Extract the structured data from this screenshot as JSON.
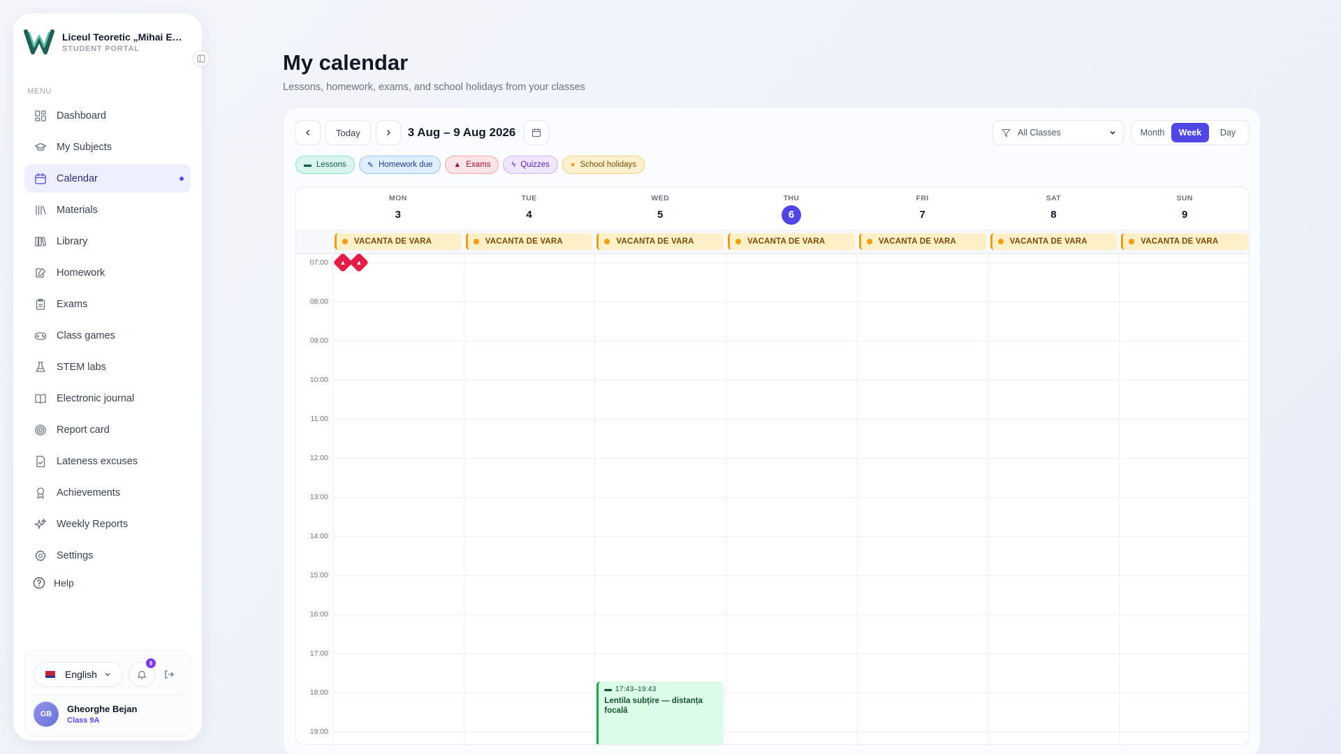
{
  "sidebar": {
    "school_name": "Liceul Teoretic „Mihai Emi…",
    "portal": "STUDENT PORTAL",
    "menu_label": "MENU",
    "items": [
      {
        "label": "Dashboard",
        "icon": "dashboard-icon"
      },
      {
        "label": "My Subjects",
        "icon": "graduation-cap-icon"
      },
      {
        "label": "Calendar",
        "icon": "calendar-icon",
        "active": true
      },
      {
        "label": "Materials",
        "icon": "materials-icon"
      },
      {
        "label": "Library",
        "icon": "library-icon"
      },
      {
        "label": "Homework",
        "icon": "homework-icon"
      },
      {
        "label": "Exams",
        "icon": "clipboard-icon"
      },
      {
        "label": "Class games",
        "icon": "gamepad-icon"
      },
      {
        "label": "STEM labs",
        "icon": "flask-icon"
      },
      {
        "label": "Electronic journal",
        "icon": "book-open-icon"
      },
      {
        "label": "Report card",
        "icon": "target-icon"
      },
      {
        "label": "Lateness excuses",
        "icon": "file-check-icon"
      },
      {
        "label": "Achievements",
        "icon": "award-icon"
      },
      {
        "label": "Weekly Reports",
        "icon": "sparkles-icon"
      },
      {
        "label": "Settings",
        "icon": "gear-icon"
      }
    ],
    "help": "Help",
    "language": "English",
    "notifications_count": "9",
    "user": {
      "initials": "GB",
      "name": "Gheorghe Bejan",
      "class": "Class 9A"
    }
  },
  "page": {
    "title": "My calendar",
    "subtitle": "Lessons, homework, exams, and school holidays from your classes"
  },
  "toolbar": {
    "today": "Today",
    "range": "3 Aug – 9 Aug 2026",
    "filter": "All Classes",
    "views": [
      "Month",
      "Week",
      "Day"
    ],
    "active_view": "Week"
  },
  "legend": [
    {
      "label": "Lessons",
      "icon": "book-icon"
    },
    {
      "label": "Homework due",
      "icon": "pencil-icon"
    },
    {
      "label": "Exams",
      "icon": "graduation-cap-icon"
    },
    {
      "label": "Quizzes",
      "icon": "lightning-icon"
    },
    {
      "label": "School holidays",
      "icon": "sun-icon"
    }
  ],
  "days": [
    {
      "name": "MON",
      "num": "3"
    },
    {
      "name": "TUE",
      "num": "4"
    },
    {
      "name": "WED",
      "num": "5"
    },
    {
      "name": "THU",
      "num": "6",
      "today": true
    },
    {
      "name": "FRI",
      "num": "7"
    },
    {
      "name": "SAT",
      "num": "8"
    },
    {
      "name": "SUN",
      "num": "9"
    }
  ],
  "holiday_label": "VACANTA DE VARA",
  "hours": [
    "07:00",
    "08:00",
    "09:00",
    "10:00",
    "11:00",
    "12:00",
    "13:00",
    "14:00",
    "15:00",
    "16:00",
    "17:00",
    "18:00",
    "19:00"
  ],
  "events": [
    {
      "day": 2,
      "start": "17:43",
      "end": "19:43",
      "time": "17:43–19:43",
      "title": "Lentila subțire — distanța focală",
      "type": "lesson"
    }
  ],
  "colors": {
    "accent": "#4f46e5",
    "holiday": "#f59e0b",
    "lesson": "#16a34a",
    "exam": "#e11d48"
  }
}
